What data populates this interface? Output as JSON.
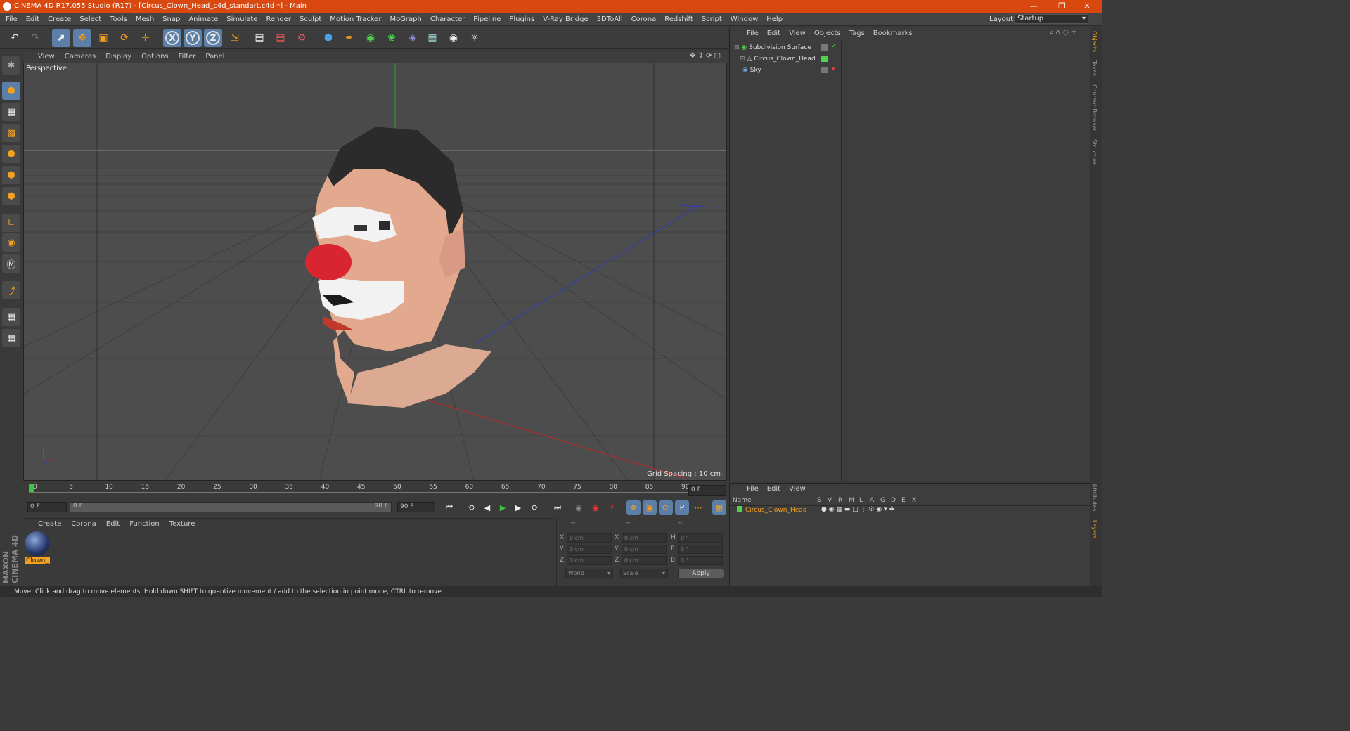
{
  "window": {
    "title": "CINEMA 4D R17.055 Studio (R17) - [Circus_Clown_Head_c4d_standart.c4d *] - Main"
  },
  "menu": [
    "File",
    "Edit",
    "Create",
    "Select",
    "Tools",
    "Mesh",
    "Snap",
    "Animate",
    "Simulate",
    "Render",
    "Sculpt",
    "Motion Tracker",
    "MoGraph",
    "Character",
    "Pipeline",
    "Plugins",
    "V-Ray Bridge",
    "3DToAll",
    "Corona",
    "Redshift",
    "Script",
    "Window",
    "Help"
  ],
  "layout": {
    "label": "Layout:",
    "value": "Startup"
  },
  "viewport": {
    "menu": [
      "View",
      "Cameras",
      "Display",
      "Options",
      "Filter",
      "Panel"
    ],
    "label": "Perspective",
    "grid_spacing": "Grid Spacing : 10 cm"
  },
  "timeline": {
    "ticks": [
      "0",
      "5",
      "10",
      "15",
      "20",
      "25",
      "30",
      "35",
      "40",
      "45",
      "50",
      "55",
      "60",
      "65",
      "70",
      "75",
      "80",
      "85",
      "90"
    ],
    "current": "0 F",
    "start": "0 F",
    "slider_left": "0 F",
    "slider_right": "90 F",
    "end": "90 F"
  },
  "material": {
    "menu": [
      "Create",
      "Corona",
      "Edit",
      "Function",
      "Texture"
    ],
    "swatch_label": "Clown_"
  },
  "coords": {
    "headers": [
      "--",
      "--",
      "--"
    ],
    "rows": [
      {
        "a": "X",
        "av": "0 cm",
        "b": "X",
        "bv": "0 cm",
        "c": "H",
        "cv": "0 °"
      },
      {
        "a": "Y",
        "av": "0 cm",
        "b": "Y",
        "bv": "0 cm",
        "c": "P",
        "cv": "0 °"
      },
      {
        "a": "Z",
        "av": "0 cm",
        "b": "Z",
        "bv": "0 cm",
        "c": "B",
        "cv": "0 °"
      }
    ],
    "mode1": "World",
    "mode2": "Scale",
    "apply": "Apply"
  },
  "objects": {
    "menu": [
      "File",
      "Edit",
      "View",
      "Objects",
      "Tags",
      "Bookmarks"
    ],
    "items": [
      "Subdivision Surface",
      "Circus_Clown_Head",
      "Sky"
    ]
  },
  "layers": {
    "menu": [
      "File",
      "Edit",
      "View"
    ],
    "columns": [
      "Name",
      "S",
      "V",
      "R",
      "M",
      "L",
      "A",
      "G",
      "D",
      "E",
      "X"
    ],
    "row": "Circus_Clown_Head"
  },
  "side_tabs": [
    "Objects",
    "Takes",
    "Content Browser",
    "Structure",
    "Attributes",
    "Layers"
  ],
  "brand": "MAXON CINEMA 4D",
  "status": "Move: Click and drag to move elements. Hold down SHIFT to quantize movement / add to the selection in point mode, CTRL to remove."
}
